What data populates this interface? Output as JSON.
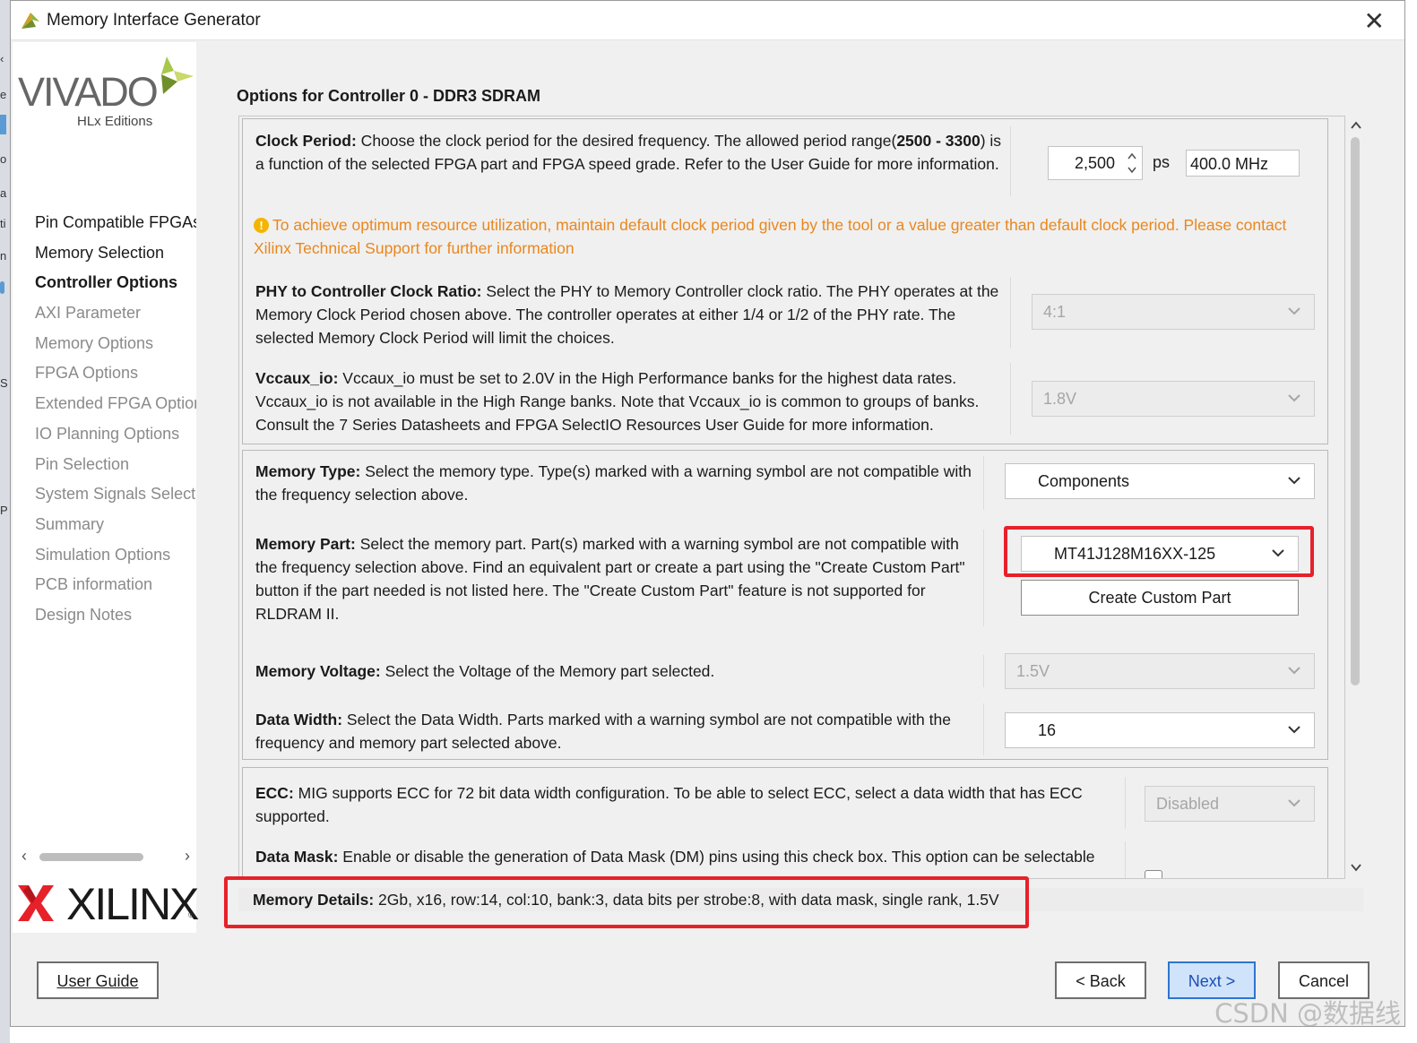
{
  "window": {
    "title": "Memory Interface Generator",
    "close_icon": "close-icon"
  },
  "sidebar": {
    "logo_text": "VIVADO",
    "logo_subtext": "HLx Editions",
    "items": [
      {
        "label": "Pin Compatible FPGAs",
        "state": "done"
      },
      {
        "label": "Memory Selection",
        "state": "done"
      },
      {
        "label": "Controller Options",
        "state": "current"
      },
      {
        "label": "AXI Parameter",
        "state": "pending"
      },
      {
        "label": "Memory Options",
        "state": "pending"
      },
      {
        "label": "FPGA Options",
        "state": "pending"
      },
      {
        "label": "Extended FPGA Options",
        "state": "pending"
      },
      {
        "label": "IO Planning Options",
        "state": "pending"
      },
      {
        "label": "Pin Selection",
        "state": "pending"
      },
      {
        "label": "System Signals Selection",
        "state": "pending"
      },
      {
        "label": "Summary",
        "state": "pending"
      },
      {
        "label": "Simulation Options",
        "state": "pending"
      },
      {
        "label": "PCB information",
        "state": "pending"
      },
      {
        "label": "Design Notes",
        "state": "pending"
      }
    ],
    "footer_logo": "XILINX"
  },
  "main": {
    "heading": "Options for Controller 0 - DDR3 SDRAM",
    "clock_period": {
      "label": "Clock Period:",
      "desc_a": " Choose the clock period for the desired frequency. The allowed period range(",
      "range": "2500 - 3300",
      "desc_b": ") is a function of the selected FPGA part and FPGA speed grade. Refer to the User Guide for more information.",
      "value": "2,500",
      "unit": "ps",
      "frequency": "400.0 MHz"
    },
    "warning": "To achieve optimum resource utilization, maintain default clock period given by the tool or a value greater than default clock period. Please contact Xilinx Technical Support for further information",
    "phy_ratio": {
      "label": "PHY to Controller Clock Ratio:",
      "desc": " Select the PHY to Memory Controller clock ratio. The PHY operates at the Memory Clock Period chosen above. The controller operates at either 1/4 or 1/2 of the PHY rate. The selected Memory Clock Period will limit the choices.",
      "value": "4:1"
    },
    "vccaux": {
      "label": "Vccaux_io:",
      "desc": " Vccaux_io must be set to 2.0V in the High Performance banks for the highest data rates. Vccaux_io is not available in the High Range banks. Note that Vccaux_io is common to groups of banks. Consult the 7 Series Datasheets and FPGA SelectIO Resources User Guide for more information.",
      "value": "1.8V"
    },
    "memory_type": {
      "label": "Memory Type:",
      "desc": " Select the memory type. Type(s) marked with a warning symbol are not compatible with the frequency selection above.",
      "value": "Components"
    },
    "memory_part": {
      "label": "Memory Part:",
      "desc": " Select the memory part. Part(s) marked with a warning symbol are not compatible with the frequency selection above. Find an equivalent part or create a part using the \"Create Custom Part\" button if the part needed is not listed here. The \"Create Custom Part\" feature is not supported for RLDRAM II.",
      "value": "MT41J128M16XX-125",
      "custom_button": "Create Custom Part"
    },
    "memory_voltage": {
      "label": "Memory Voltage:",
      "desc": " Select the Voltage of the Memory part selected.",
      "value": "1.5V"
    },
    "data_width": {
      "label": "Data Width:",
      "desc": " Select the Data Width. Parts marked with a warning symbol are not compatible with the frequency and memory part selected above.",
      "value": "16"
    },
    "ecc": {
      "label": "ECC:",
      "desc": " MIG supports ECC for 72 bit data width configuration. To be able to select ECC, select a data width that has ECC supported.",
      "value": "Disabled"
    },
    "data_mask": {
      "label": "Data Mask:",
      "desc": " Enable or disable the generation of Data Mask (DM) pins using this check box. This option can be selectable"
    },
    "memory_details": {
      "label": "Memory Details:",
      "value": " 2Gb, x16, row:14, col:10, bank:3, data bits per strobe:8, with data mask, single rank, 1.5V"
    }
  },
  "footer": {
    "user_guide": "User Guide",
    "back": "< Back",
    "next": "Next >",
    "cancel": "Cancel"
  },
  "watermark": "CSDN @数据线",
  "colors": {
    "warning": "#e9871e",
    "highlight_box": "#e6212a",
    "next_button_border": "#2f74d0",
    "xilinx_logo": "#e6212a"
  }
}
